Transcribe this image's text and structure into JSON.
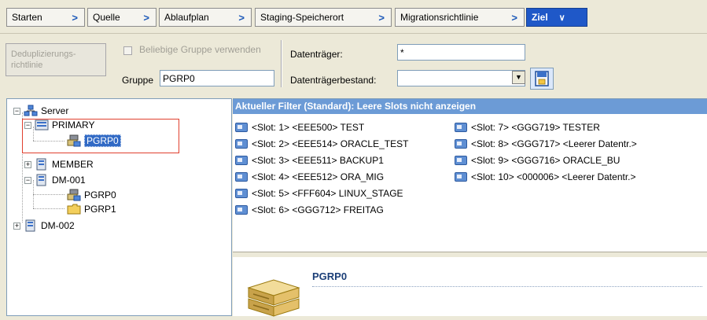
{
  "tabs": [
    {
      "label": "Starten"
    },
    {
      "label": "Quelle"
    },
    {
      "label": "Ablaufplan"
    },
    {
      "label": "Staging-Speicherort"
    },
    {
      "label": "Migrationsrichtlinie"
    },
    {
      "label": "Ziel"
    }
  ],
  "toolbar": {
    "dedup_button_label": "Deduplizierungs-richtlinie",
    "any_group_checkbox_label": "Beliebige Gruppe verwenden",
    "any_group_checked": false,
    "group_label": "Gruppe",
    "group_value": "PGRP0",
    "media_label": "Datenträger:",
    "media_value": "*",
    "media_pool_label": "Datenträgerbestand:",
    "media_pool_value": ""
  },
  "tree": {
    "root": "Server",
    "nodes": [
      {
        "label": "PRIMARY"
      },
      {
        "label": "PGRP0"
      },
      {
        "label": "MEMBER"
      },
      {
        "label": "DM-001"
      },
      {
        "label": "PGRP0"
      },
      {
        "label": "PGRP1"
      },
      {
        "label": "DM-002"
      }
    ]
  },
  "slots": {
    "filter_text": "Aktueller Filter (Standard): Leere Slots nicht anzeigen",
    "items": [
      {
        "text": "<Slot: 1> <EEE500> TEST"
      },
      {
        "text": "<Slot: 2> <EEE514> ORACLE_TEST"
      },
      {
        "text": "<Slot: 3> <EEE511> BACKUP1"
      },
      {
        "text": "<Slot: 4> <EEE512> ORA_MIG"
      },
      {
        "text": "<Slot: 5> <FFF604> LINUX_STAGE"
      },
      {
        "text": "<Slot: 6> <GGG712> FREITAG"
      },
      {
        "text": "<Slot: 7> <GGG719> TESTER"
      },
      {
        "text": "<Slot: 8> <GGG717> <Leerer Datentr.>"
      },
      {
        "text": "<Slot: 9> <GGG716> ORACLE_BU"
      },
      {
        "text": "<Slot: 10> <000006> <Leerer Datentr.>"
      }
    ]
  },
  "detail": {
    "title": "PGRP0"
  },
  "colors": {
    "tab_active": "#1f58c8",
    "filter_bar": "#6c9bd6",
    "selection": "#316ac5",
    "highlight_box": "#e0402f"
  }
}
